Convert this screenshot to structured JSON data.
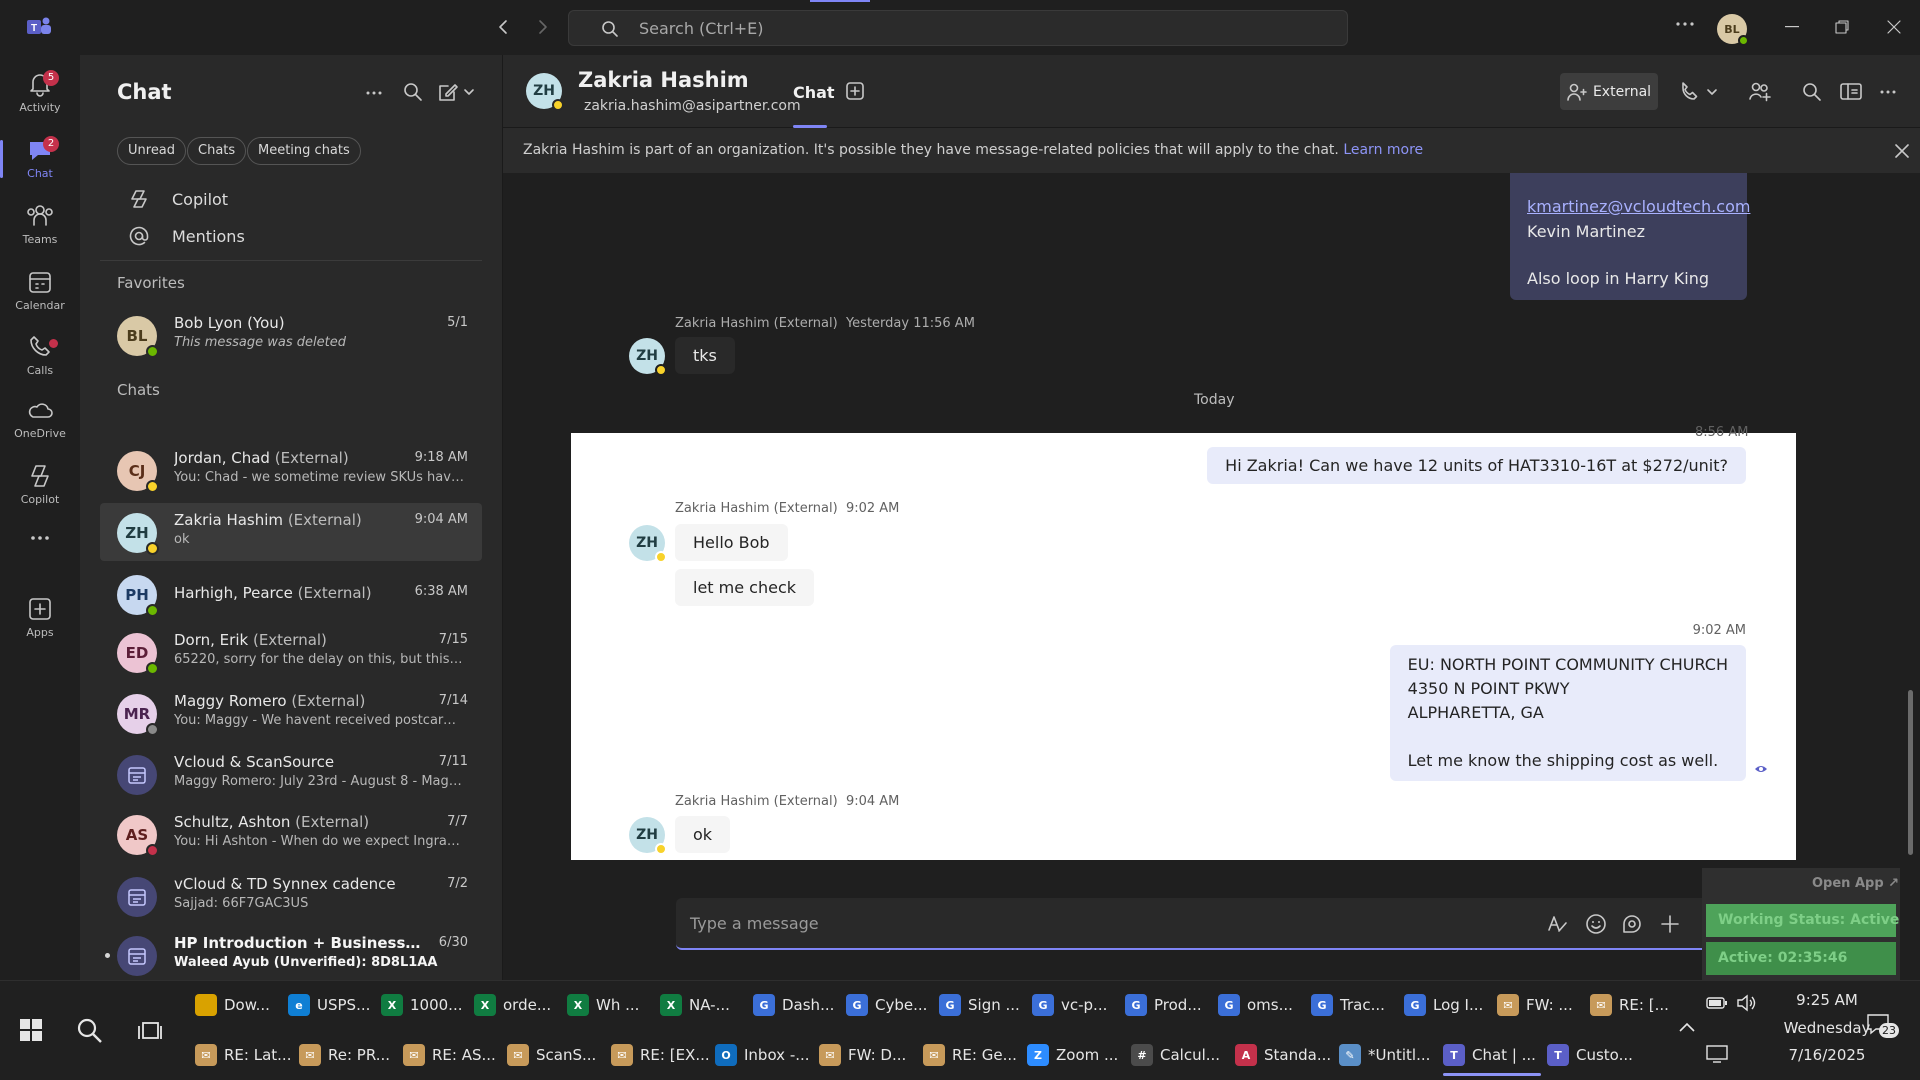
{
  "titlebar": {
    "search_placeholder": "Search (Ctrl+E)",
    "user_initials": "BL"
  },
  "rail": [
    {
      "label": "Activity",
      "badge": "5",
      "icon": "bell-icon"
    },
    {
      "label": "Chat",
      "badge": "2",
      "icon": "chat-icon",
      "active": true
    },
    {
      "label": "Teams",
      "icon": "teams-icon"
    },
    {
      "label": "Calendar",
      "icon": "calendar-icon"
    },
    {
      "label": "Calls",
      "icon": "phone-icon"
    },
    {
      "label": "OneDrive",
      "icon": "cloud-icon"
    },
    {
      "label": "Copilot",
      "icon": "copilot-icon"
    },
    {
      "label": "Apps",
      "icon": "plus-square-icon"
    }
  ],
  "panel": {
    "title": "Chat",
    "filters": [
      "Unread",
      "Chats",
      "Meeting chats"
    ],
    "nav": [
      "Copilot",
      "Mentions"
    ],
    "favorites_label": "Favorites",
    "chats_label": "Chats",
    "favorites": [
      {
        "initials": "BL",
        "name": "Bob Lyon (You)",
        "ext": "",
        "preview": "This message was deleted",
        "time": "5/1",
        "bg": "#d9c9a6",
        "fg": "#4b3c1c",
        "presence": "#6bb700"
      }
    ],
    "chats": [
      {
        "initials": "CJ",
        "name": "Jordan, Chad",
        "ext": "(External)",
        "preview": "You: Chad -  we sometime review SKUs havin...",
        "time": "9:18 AM",
        "bg": "#e7c6b3",
        "fg": "#5a2e19",
        "presence": "#f8d22a"
      },
      {
        "initials": "ZH",
        "name": "Zakria Hashim",
        "ext": "(External)",
        "preview": "ok",
        "time": "9:04 AM",
        "bg": "#c3e1e8",
        "fg": "#213d42",
        "presence": "#f8d22a"
      },
      {
        "initials": "PH",
        "name": "Harhigh, Pearce",
        "ext": "(External)",
        "preview": "",
        "time": "6:38 AM",
        "bg": "#c7d8f0",
        "fg": "#1c3a63",
        "presence": "#6bb700"
      },
      {
        "initials": "ED",
        "name": "Dorn, Erik",
        "ext": "(External)",
        "preview": "65220, sorry for the delay on this, but this has...",
        "time": "7/15",
        "bg": "#ecc3d4",
        "fg": "#5c1e38",
        "presence": "#6bb700"
      },
      {
        "initials": "MR",
        "name": "Maggy Romero",
        "ext": "(External)",
        "preview": "You: Maggy - We havent received postcard fo...",
        "time": "7/14",
        "bg": "#e6d0e9",
        "fg": "#4b2350",
        "presence": "#8a8a8a"
      },
      {
        "initials": "",
        "name": "Vcloud & ScanSource",
        "ext": "",
        "preview": "Maggy Romero: July 23rd - August 8 - Maggy...",
        "time": "7/11",
        "bg": "#464775",
        "fg": "#c5c8ff",
        "presence": ""
      },
      {
        "initials": "AS",
        "name": "Schultz, Ashton",
        "ext": "(External)",
        "preview": "You: Hi Ashton - When do we expect Ingram ...",
        "time": "7/7",
        "bg": "#f0c8c8",
        "fg": "#5e1f1f",
        "presence": "#c4314b"
      },
      {
        "initials": "",
        "name": "vCloud & TD Synnex cadence",
        "ext": "",
        "preview": "Sajjad: 66F7GAC3US",
        "time": "7/2",
        "bg": "#464775",
        "fg": "#c5c8ff",
        "presence": ""
      },
      {
        "initials": "",
        "name": "HP Introduction + Business Dis...",
        "ext": "",
        "preview": "Waleed Ayub (Unverified): 8D8L1AA",
        "time": "6/30",
        "bg": "#464775",
        "fg": "#c5c8ff",
        "presence": "",
        "bold": true
      }
    ]
  },
  "conversation": {
    "initials": "ZH",
    "name": "Zakria Hashim",
    "email": "zakria.hashim@asipartner.com",
    "tab": "Chat",
    "external_label": "External",
    "banner_text": "Zakria Hashim is part of an organization. It's possible they have message-related policies that will apply to the chat.",
    "banner_link": "Learn more",
    "today_label": "Today",
    "prev_out": {
      "email": "kmartinez@vcloudtech.com",
      "line1": "Kevin Martinez",
      "line2": "Also loop in Harry King"
    },
    "yesterday": {
      "sender": "Zakria Hashim (External)",
      "time": "Yesterday 11:56 AM",
      "text": "tks"
    },
    "out1": {
      "time": "8:56 AM",
      "text": "Hi Zakria! Can we have 12 units of HAT3310-16T at $272/unit?"
    },
    "in1": {
      "sender": "Zakria Hashim (External)",
      "time": "9:02 AM",
      "texts": [
        "Hello Bob",
        "let me check"
      ]
    },
    "out2": {
      "time": "9:02 AM",
      "lines": [
        "EU: NORTH POINT COMMUNITY CHURCH",
        "4350 N POINT PKWY",
        "ALPHARETTA, GA",
        "",
        "Let me know the shipping cost as well."
      ]
    },
    "in2": {
      "sender": "Zakria Hashim (External)",
      "time": "9:04 AM",
      "text": "ok"
    },
    "compose_placeholder": "Type a message"
  },
  "widget": {
    "open_app": "Open App ↗",
    "status": "Working Status: Active",
    "active": "Active: 02:35:46"
  },
  "taskbar": {
    "row1": [
      {
        "label": "Dow...",
        "color": "#d9a200",
        "g": ""
      },
      {
        "label": "USPS...",
        "color": "#0f7fd4",
        "g": "e"
      },
      {
        "label": "1000...",
        "color": "#107c41",
        "g": "X"
      },
      {
        "label": "orde...",
        "color": "#107c41",
        "g": "X"
      },
      {
        "label": "Wh ...",
        "color": "#107c41",
        "g": "X"
      },
      {
        "label": "NA-...",
        "color": "#107c41",
        "g": "X"
      },
      {
        "label": "Dash...",
        "color": "#3b6fd8",
        "g": "G"
      },
      {
        "label": "Cybe...",
        "color": "#3b6fd8",
        "g": "G"
      },
      {
        "label": "Sign ...",
        "color": "#3b6fd8",
        "g": "G"
      },
      {
        "label": "vc-p...",
        "color": "#3b6fd8",
        "g": "G"
      },
      {
        "label": "Prod...",
        "color": "#3b6fd8",
        "g": "G"
      },
      {
        "label": "oms...",
        "color": "#3b6fd8",
        "g": "G"
      },
      {
        "label": "Trac...",
        "color": "#3b6fd8",
        "g": "G"
      },
      {
        "label": "Log I...",
        "color": "#3b6fd8",
        "g": "G"
      },
      {
        "label": "FW: ...",
        "color": "#c79a5a",
        "g": "✉"
      },
      {
        "label": "RE: [...",
        "color": "#c79a5a",
        "g": "✉"
      }
    ],
    "row2": [
      {
        "label": "RE: Lat...",
        "color": "#c79a5a",
        "g": "✉"
      },
      {
        "label": "Re: PR...",
        "color": "#c79a5a",
        "g": "✉"
      },
      {
        "label": "RE: AS...",
        "color": "#c79a5a",
        "g": "✉"
      },
      {
        "label": "ScanS...",
        "color": "#c79a5a",
        "g": "✉"
      },
      {
        "label": "RE: [EX...",
        "color": "#c79a5a",
        "g": "✉"
      },
      {
        "label": "Inbox -...",
        "color": "#0f6cbd",
        "g": "O"
      },
      {
        "label": "FW: D...",
        "color": "#c79a5a",
        "g": "✉"
      },
      {
        "label": "RE: Ge...",
        "color": "#c79a5a",
        "g": "✉"
      },
      {
        "label": "Zoom ...",
        "color": "#2d8cff",
        "g": "Z"
      },
      {
        "label": "Calcul...",
        "color": "#4b4b4b",
        "g": "#"
      },
      {
        "label": "Standa...",
        "color": "#c4314b",
        "g": "A"
      },
      {
        "label": "*Untitl...",
        "color": "#5a8fc7",
        "g": "✎"
      },
      {
        "label": "Chat | ...",
        "color": "#5b5fc7",
        "g": "T",
        "active": true
      },
      {
        "label": "Custo...",
        "color": "#5b5fc7",
        "g": "T"
      }
    ],
    "clock_time": "9:25 AM",
    "clock_day": "Wednesday",
    "clock_date": "7/16/2025",
    "notif_count": "23"
  }
}
